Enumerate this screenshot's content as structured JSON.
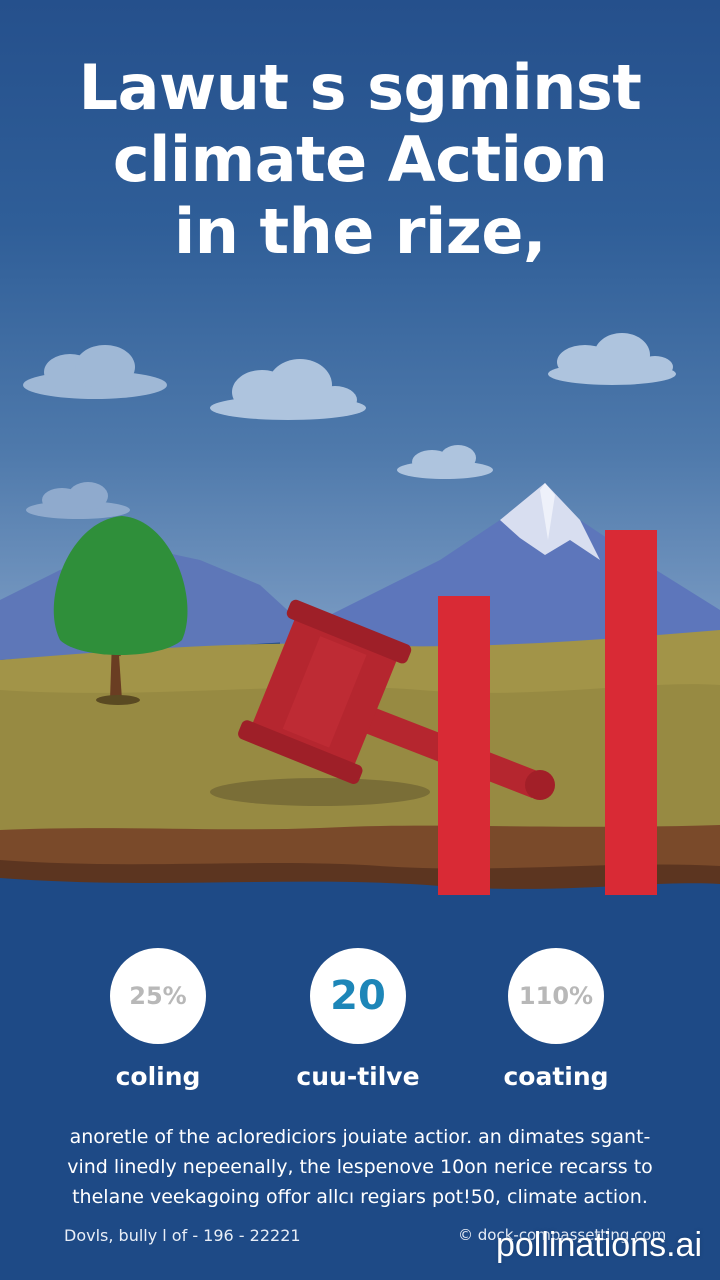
{
  "title": {
    "line1": "Lawut s sgminst",
    "line2": "climate Action",
    "line3": "in the rize,"
  },
  "stats": [
    {
      "value": "25%",
      "label": "coling",
      "value_color": "#b8b8b8"
    },
    {
      "value": "20",
      "label": "cuu-tilve",
      "value_color": "#1d86b8"
    },
    {
      "value": "110%",
      "label": "coating",
      "value_color": "#b8b8b8"
    }
  ],
  "paragraph": {
    "line1": "anoretle of the aclorediciors jouiate actior. an dimates sgant-",
    "line2": "vind linedly nepeenally, the lespenove 10on nerice recarss to",
    "line3": "thelane veekagoing offor allcı regiars pot!50, climate action."
  },
  "footer": {
    "left": "Dovls, bully l of - 196 - 22221",
    "right": "© dock-compassetting.com"
  },
  "watermark": "pollinations.ai",
  "colors": {
    "background": "#1e4a86",
    "bar": "#d92a35",
    "gavel": "#b5262f",
    "tree": "#2f8f3a"
  },
  "icons": [
    "cloud-icon",
    "mountain-icon",
    "tree-icon",
    "gavel-icon",
    "bar-icon"
  ]
}
